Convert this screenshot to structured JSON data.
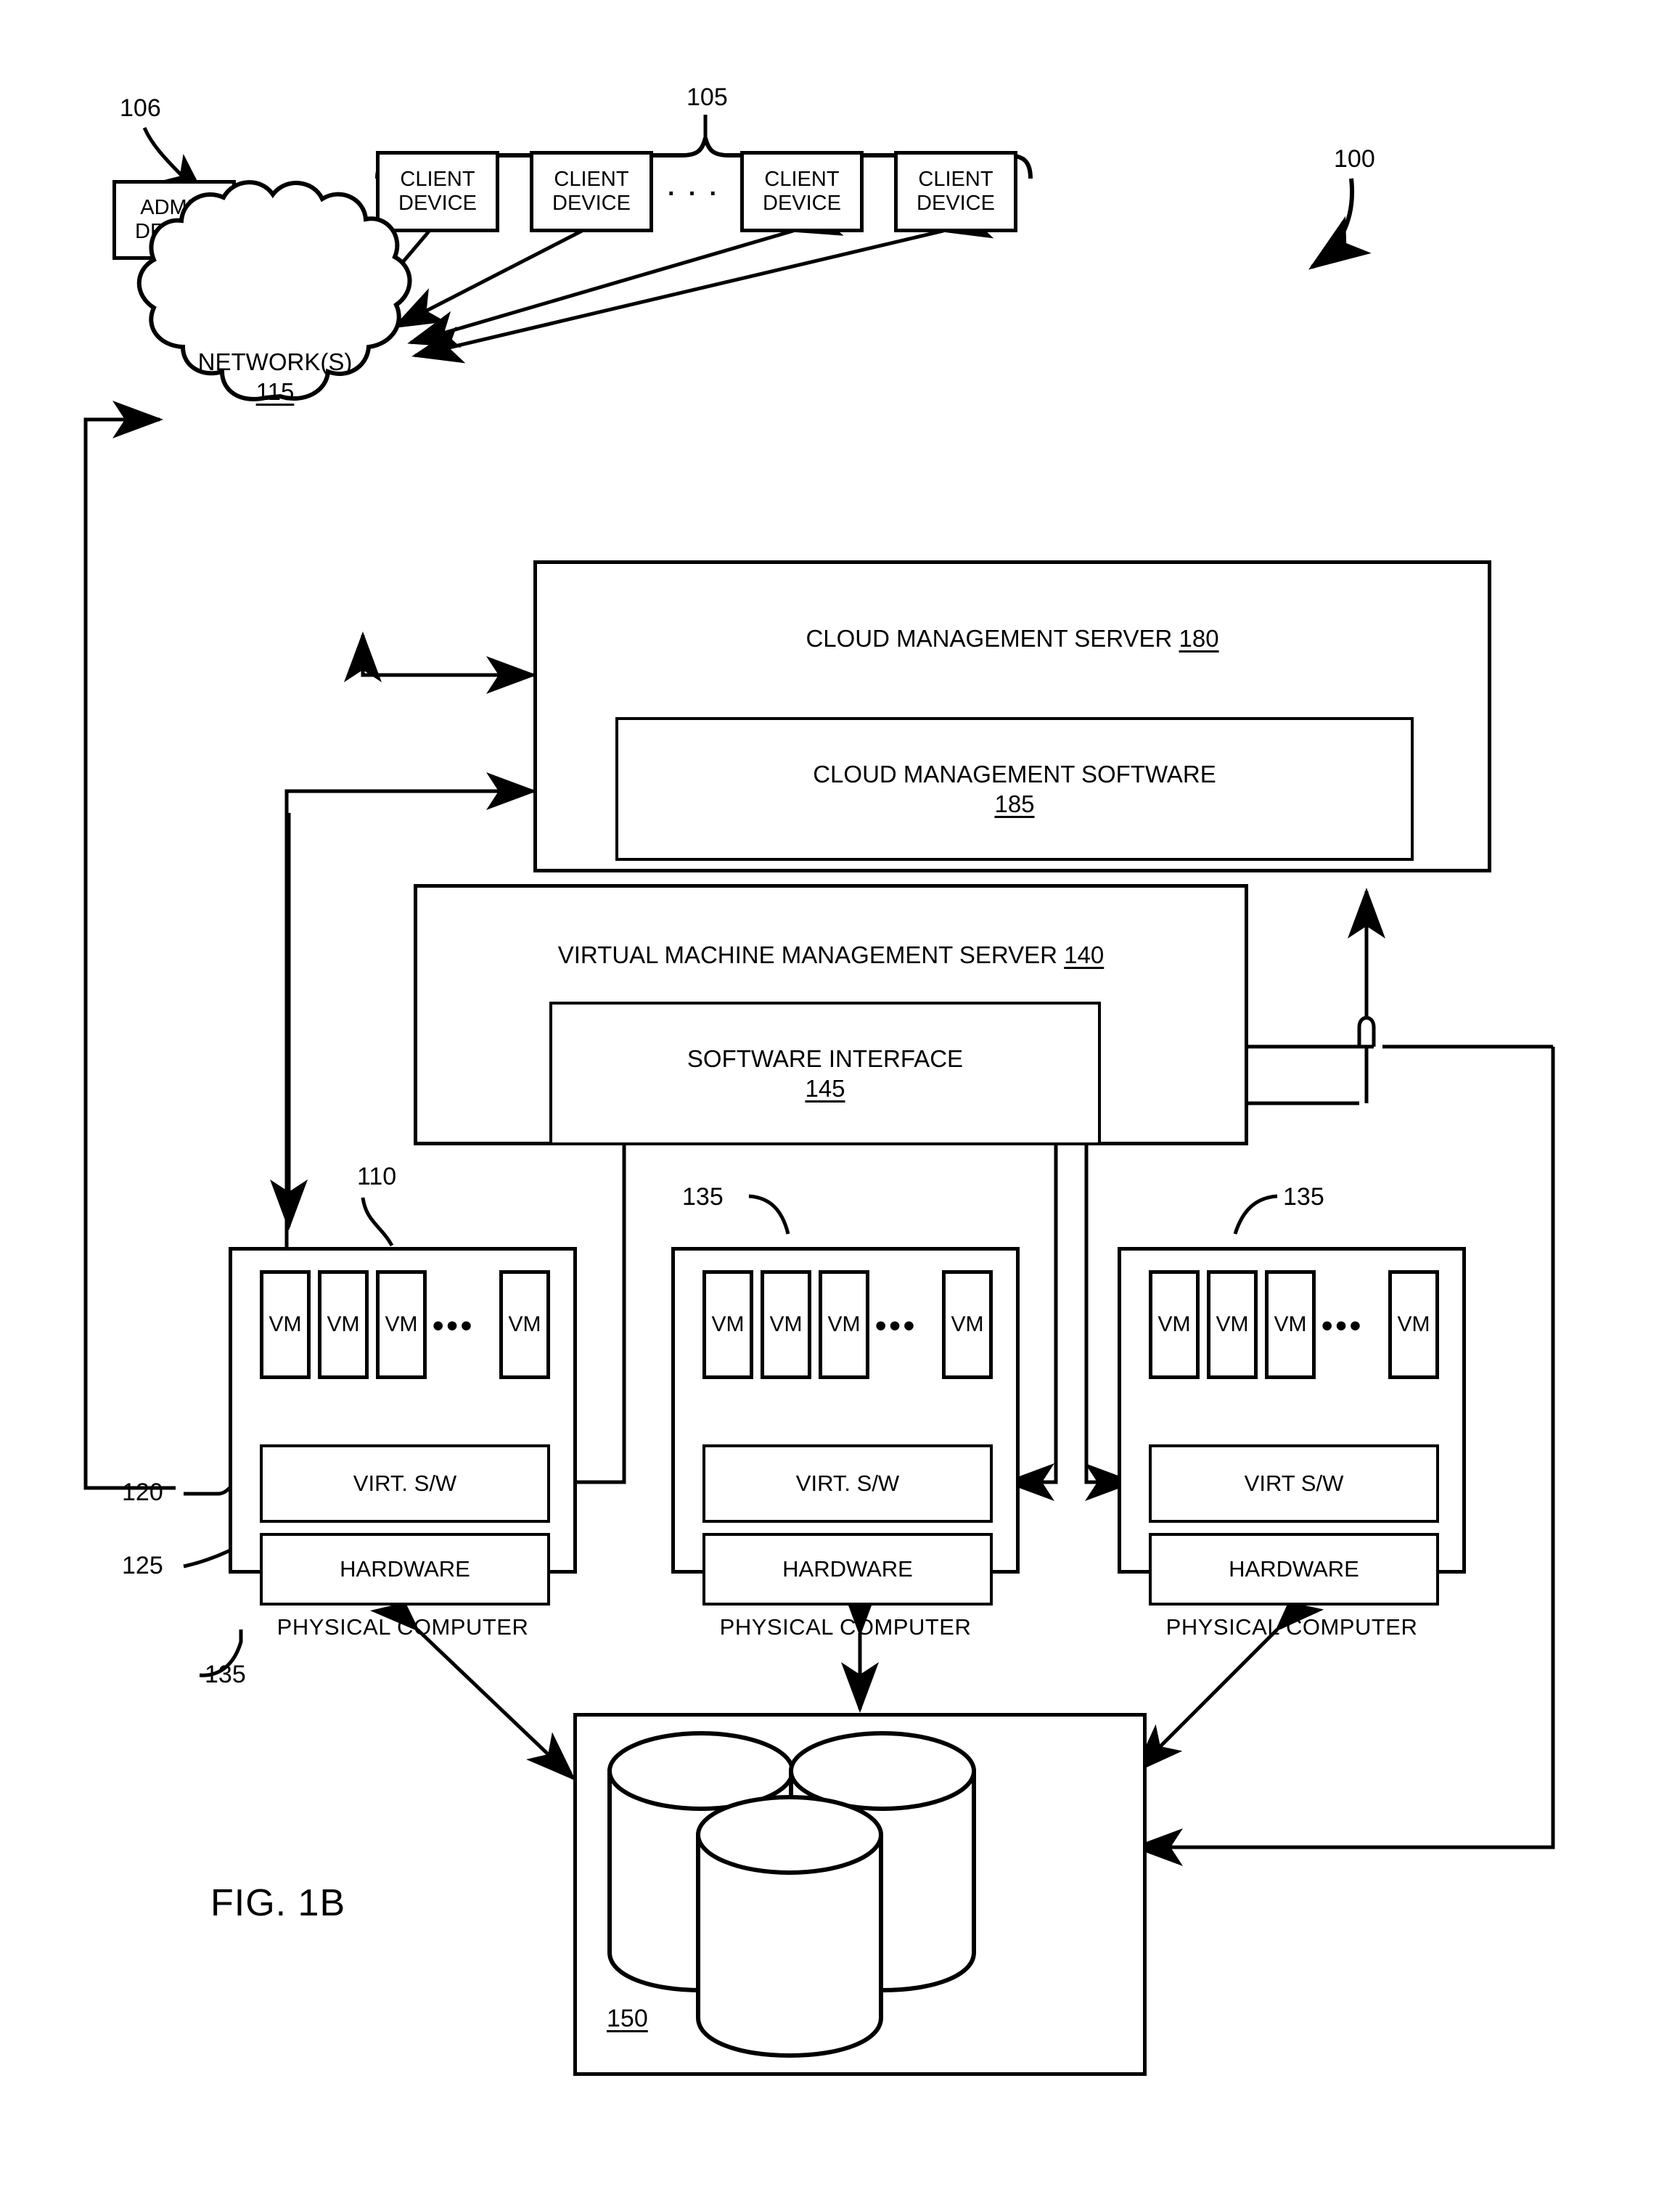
{
  "figure": {
    "label": "FIG. 1B",
    "system_ref": "100"
  },
  "client_group": {
    "ref": "105",
    "devices": [
      {
        "line1": "CLIENT",
        "line2": "DEVICE"
      },
      {
        "line1": "CLIENT",
        "line2": "DEVICE"
      },
      {
        "line1": "CLIENT",
        "line2": "DEVICE"
      },
      {
        "line1": "CLIENT",
        "line2": "DEVICE"
      }
    ],
    "ellipsis": "· · ·"
  },
  "admin_device": {
    "ref": "106",
    "line1": "ADMIN",
    "line2": "DEVICE"
  },
  "network": {
    "label": "NETWORK(S)",
    "ref": "115"
  },
  "cloud_management_server": {
    "title": "CLOUD MANAGEMENT SERVER",
    "ref": "180",
    "software": {
      "title": "CLOUD MANAGEMENT SOFTWARE",
      "ref": "185"
    }
  },
  "vm_management_server": {
    "title": "VIRTUAL MACHINE MANAGEMENT SERVER",
    "ref": "140",
    "interface": {
      "title": "SOFTWARE INTERFACE",
      "ref": "145"
    }
  },
  "physical_computers": [
    {
      "ref": "135",
      "vm_ref": "110",
      "vm_label": "VM",
      "vm_count": 4,
      "ellipsis": "•••",
      "virt_sw": {
        "label": "VIRT. S/W",
        "ref": "120"
      },
      "hardware": {
        "label": "HARDWARE",
        "ref": "125"
      },
      "caption": "PHYSICAL COMPUTER"
    },
    {
      "ref": "135",
      "vm_label": "VM",
      "vm_count": 4,
      "ellipsis": "•••",
      "virt_sw": {
        "label": "VIRT. S/W"
      },
      "hardware": {
        "label": "HARDWARE"
      },
      "caption": "PHYSICAL COMPUTER"
    },
    {
      "ref": "135",
      "vm_label": "VM",
      "vm_count": 4,
      "ellipsis": "•••",
      "virt_sw": {
        "label": "VIRT S/W"
      },
      "hardware": {
        "label": "HARDWARE"
      },
      "caption": "PHYSICAL COMPUTER"
    }
  ],
  "storage": {
    "ref": "150"
  },
  "colors": {
    "stroke": "#000000",
    "fill": "#ffffff"
  }
}
